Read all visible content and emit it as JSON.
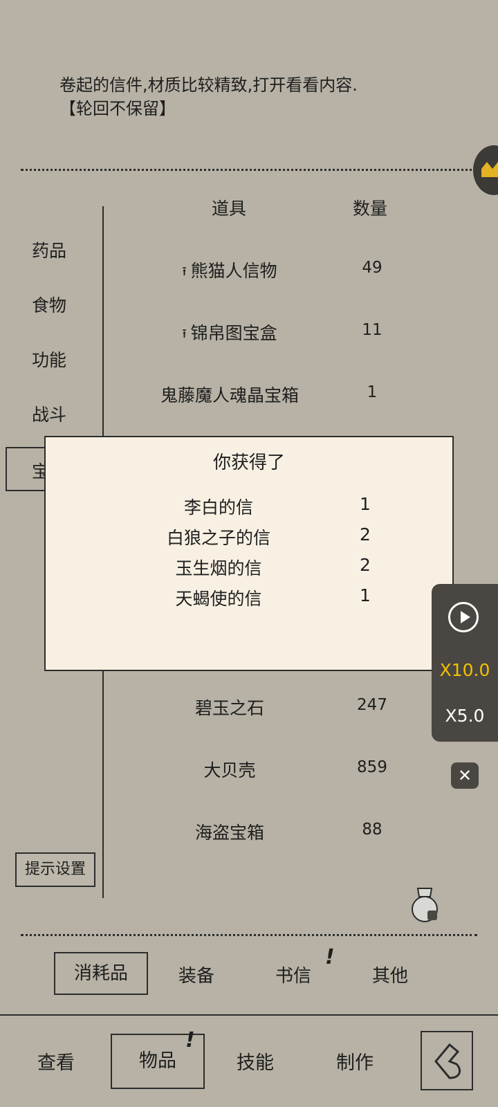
{
  "description": {
    "line1": "卷起的信件,材质比较精致,打开看看内容.",
    "line2": "【轮回不保留】"
  },
  "categories": [
    "药品",
    "食物",
    "功能",
    "战斗",
    "宝"
  ],
  "columns": {
    "item": "道具",
    "quantity": "数量"
  },
  "items_top": [
    {
      "pin": "⭱",
      "name": "熊猫人信物",
      "qty": "49"
    },
    {
      "pin": "⭱",
      "name": "锦帛图宝盒",
      "qty": "11"
    },
    {
      "pin": "",
      "name": "鬼藤魔人魂晶宝箱",
      "qty": "1"
    }
  ],
  "items_bottom": [
    {
      "name": "碧玉之石",
      "qty": "247"
    },
    {
      "name": "大贝壳",
      "qty": "859"
    },
    {
      "name": "海盗宝箱",
      "qty": "88"
    }
  ],
  "popup": {
    "title": "你获得了",
    "rewards": [
      {
        "name": "李白的信",
        "qty": "1"
      },
      {
        "name": "白狼之子的信",
        "qty": "2"
      },
      {
        "name": "玉生烟的信",
        "qty": "2"
      },
      {
        "name": "天蝎使的信",
        "qty": "1"
      }
    ]
  },
  "speed_panel": {
    "fast": "X10.0",
    "normal": "X5.0",
    "fast_color": "#f2c200"
  },
  "hint_settings": "提示设置",
  "item_tabs": {
    "consumables": "消耗品",
    "equipment": "装备",
    "letters": "书信",
    "other": "其他",
    "letters_badge": "!"
  },
  "bottom_nav": {
    "view": "查看",
    "items": "物品",
    "skills": "技能",
    "craft": "制作",
    "items_badge": "!"
  },
  "icons": [
    "play-icon",
    "close-icon",
    "money-bag-icon",
    "helmet-icon",
    "back-arrow-icon"
  ]
}
